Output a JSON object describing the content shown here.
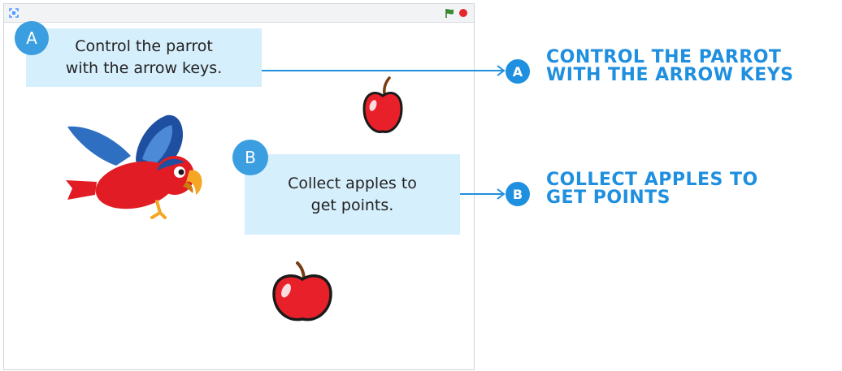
{
  "stage": {
    "callout_a": {
      "badge": "A",
      "lines": [
        "Control the parrot",
        "with the arrow keys."
      ]
    },
    "callout_b": {
      "badge": "B",
      "lines": [
        "Collect apples to",
        "get points."
      ]
    }
  },
  "annotations": {
    "a": {
      "badge": "A",
      "lines": [
        "CONTROL THE PARROT",
        "WITH THE ARROW KEYS"
      ]
    },
    "b": {
      "badge": "B",
      "lines": [
        "COLLECT APPLES TO",
        "GET POINTS"
      ]
    }
  },
  "colors": {
    "accent": "#1f8fdf",
    "callout_bg": "#d6effc",
    "stop": "#e5262b",
    "flag": "#3c8d2f"
  },
  "icons": [
    "fullscreen-icon",
    "green-flag-icon",
    "stop-icon",
    "apple-icon",
    "parrot-icon"
  ]
}
